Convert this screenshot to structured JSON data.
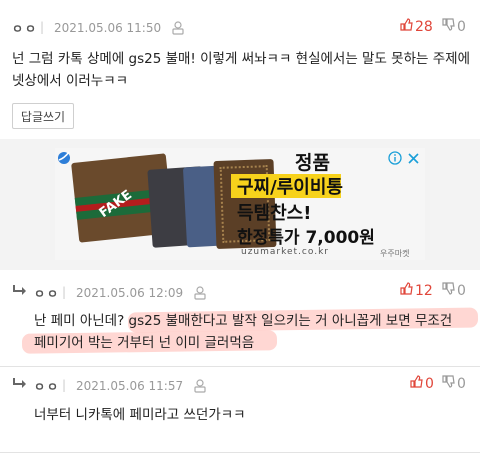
{
  "comments": [
    {
      "nickname": "ㅇㅇ",
      "date": "2021.05.06 11:50",
      "upvotes": "28",
      "downvotes": "0",
      "text_line1": "넌 그럼 카톡 상메에 gs25 불매! 이렇게 써놔ㅋㅋ 현실에서는 말도 못하는 주제에",
      "text_line2": "넷상에서 이러누ㅋㅋ",
      "reply_button": "답글쓰기"
    },
    {
      "nickname": "ㅇㅇ",
      "date": "2021.05.06 12:09",
      "upvotes": "12",
      "downvotes": "0",
      "text_line1": "난 페미 아닌데? gs25 불매한다고 발작 일으키는 거 아니꼽게 보면 무조건",
      "text_line2": "페미기어 박는 거부터 넌 이미 글러먹음"
    },
    {
      "nickname": "ㅇㅇ",
      "date": "2021.05.06 11:57",
      "upvotes": "0",
      "downvotes": "0",
      "text_line1": "너부터 니카톡에 페미라고 쓰던가ㅋㅋ"
    }
  ],
  "ad": {
    "headline1": "정품",
    "headline2": "구찌/루이비통",
    "headline3": "득템찬스!",
    "headline4": "한정특가 7,000원",
    "url": "uzumarket.co.kr",
    "brand": "우주마켓",
    "bag_label": "FAKE",
    "accent_color": "#f7d21c"
  }
}
